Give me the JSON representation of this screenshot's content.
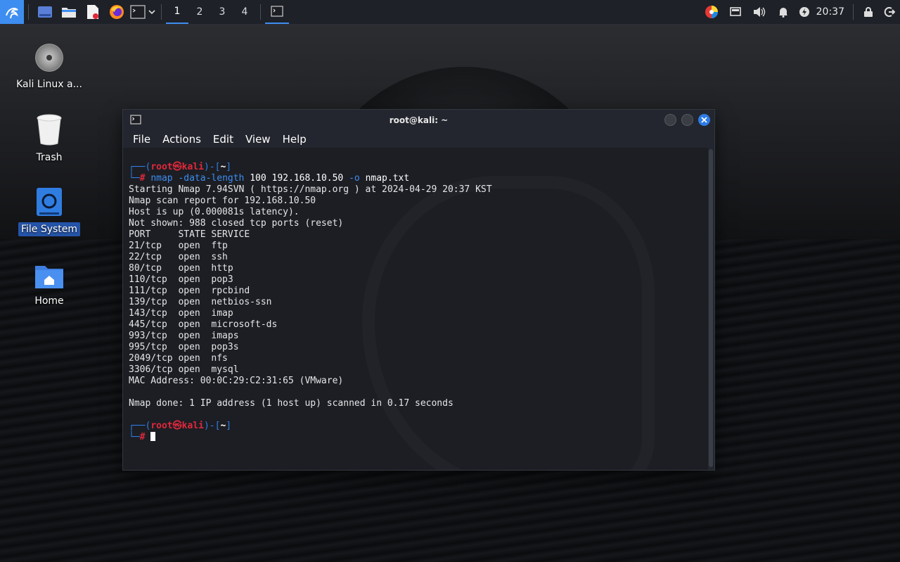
{
  "panel": {
    "workspaces": [
      "1",
      "2",
      "3",
      "4"
    ],
    "clock": "20:37"
  },
  "desktop_icons": [
    {
      "label": "Kali Linux a...",
      "icon": "disc-icon"
    },
    {
      "label": "Trash",
      "icon": "trash-icon"
    },
    {
      "label": "File System",
      "icon": "drive-icon"
    },
    {
      "label": "Home",
      "icon": "home-folder-icon"
    }
  ],
  "terminal": {
    "title": "root@kali: ~",
    "menu": [
      "File",
      "Actions",
      "Edit",
      "View",
      "Help"
    ],
    "prompt": {
      "open": "┌──(",
      "user": "root",
      "at": "㉿",
      "host": "kali",
      "mid": ")-[",
      "dir": "~",
      "close": "]",
      "hash_prefix": "└─",
      "hash": "#"
    },
    "command": {
      "prog": "nmap",
      "opt1": "-data-length",
      "arg1": "100 192.168.10.50",
      "opt2": "-o",
      "arg2": "nmap.txt"
    },
    "output": [
      "Starting Nmap 7.94SVN ( https://nmap.org ) at 2024-04-29 20:37 KST",
      "Nmap scan report for 192.168.10.50",
      "Host is up (0.000081s latency).",
      "Not shown: 988 closed tcp ports (reset)",
      "PORT     STATE SERVICE",
      "21/tcp   open  ftp",
      "22/tcp   open  ssh",
      "80/tcp   open  http",
      "110/tcp  open  pop3",
      "111/tcp  open  rpcbind",
      "139/tcp  open  netbios-ssn",
      "143/tcp  open  imap",
      "445/tcp  open  microsoft-ds",
      "993/tcp  open  imaps",
      "995/tcp  open  pop3s",
      "2049/tcp open  nfs",
      "3306/tcp open  mysql",
      "MAC Address: 00:0C:29:C2:31:65 (VMware)",
      "",
      "Nmap done: 1 IP address (1 host up) scanned in 0.17 seconds",
      ""
    ]
  },
  "colors": {
    "accent": "#3d8ef0",
    "prompt_red": "#e0283a",
    "close_button": "#2d7be6"
  }
}
